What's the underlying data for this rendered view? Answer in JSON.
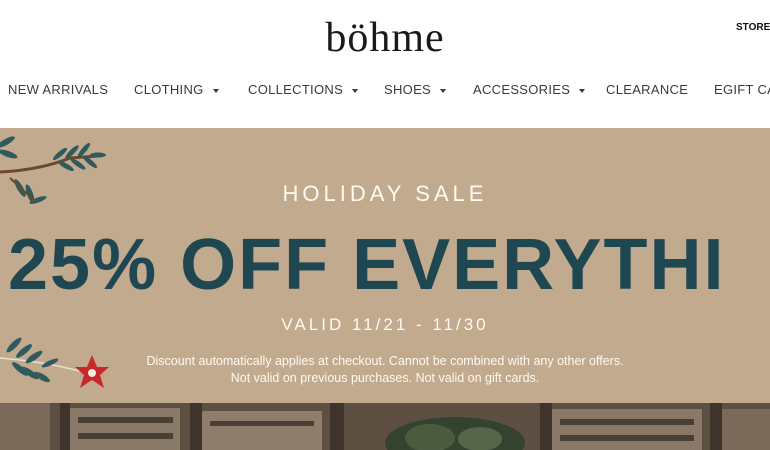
{
  "header": {
    "brand": "böhme",
    "store_link": "STORE L"
  },
  "nav": {
    "items": [
      {
        "label": "NEW ARRIVALS",
        "dropdown": false
      },
      {
        "label": "CLOTHING",
        "dropdown": true
      },
      {
        "label": "COLLECTIONS",
        "dropdown": true
      },
      {
        "label": "SHOES",
        "dropdown": true
      },
      {
        "label": "ACCESSORIES",
        "dropdown": true
      },
      {
        "label": "CLEARANCE",
        "dropdown": false
      },
      {
        "label": "EGIFT CA",
        "dropdown": false
      }
    ]
  },
  "banner": {
    "kicker": "HOLIDAY SALE",
    "headline": "25% OFF EVERYTHI",
    "valid": "VALID 11/21 - 11/30",
    "disclaimer_line1": "Discount automatically applies at checkout. Cannot be combined with any other offers.",
    "disclaimer_line2": "Not valid on previous purchases. Not valid on gift cards.",
    "colors": {
      "background": "#c1aa8d",
      "headline": "#1f4752",
      "text": "#fffaf2",
      "foliage": "#2f5a5e",
      "flower": "#c8282c"
    }
  }
}
